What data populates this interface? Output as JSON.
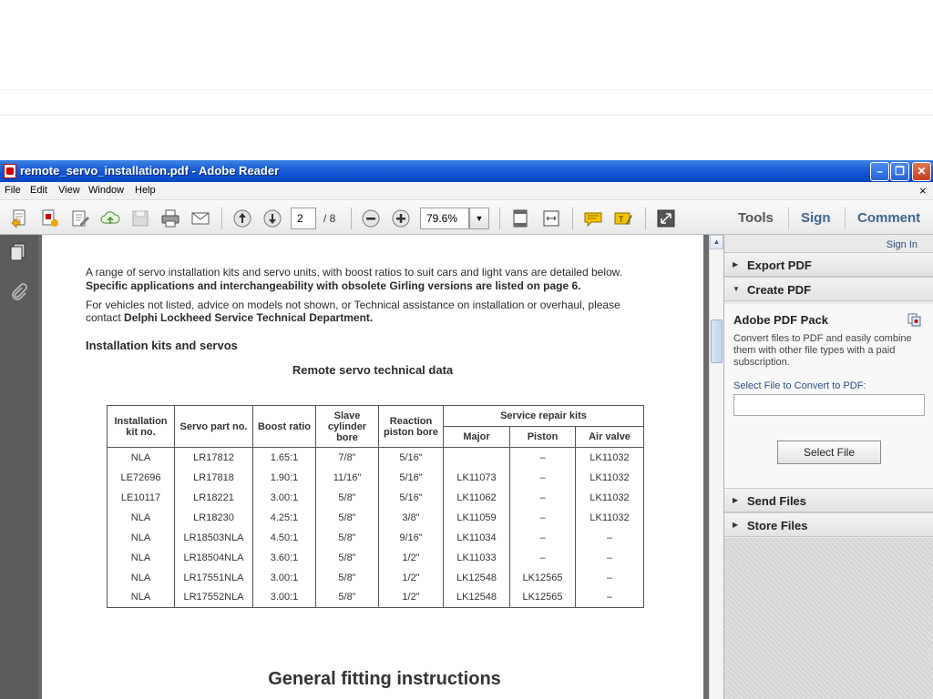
{
  "window": {
    "title": "remote_servo_installation.pdf - Adobe Reader",
    "close_symbol": "✕",
    "maximize_symbol": "❐",
    "minimize_symbol": "–"
  },
  "menu": {
    "items": [
      "File",
      "Edit",
      "View",
      "Window",
      "Help"
    ],
    "close_symbol": "×"
  },
  "toolbar": {
    "page_current": "2",
    "page_total": "/  8",
    "zoom": "79.6%",
    "zoom_drop_symbol": "▼",
    "tools_label": "Tools",
    "sign_label": "Sign",
    "comment_label": "Comment"
  },
  "document": {
    "intro_line1": "A range of servo installation kits and servo units, with boost ratios to suit cars and light vans are detailed below.",
    "intro_line1_bold": "Specific applications and interchangeability with obsolete Girling versions are listed on page 6.",
    "intro_line2": "For vehicles not listed, advice on models not shown, or Technical assistance on installation or overhaul, please",
    "intro_line2b_prefix": "contact ",
    "intro_line2b_bold": "Delphi Lockheed Service Technical Department.",
    "section_heading": "Installation kits and servos",
    "table_title": "Remote servo technical data",
    "table_headers": {
      "installation_kit": "Installation kit no.",
      "servo_part": "Servo part no.",
      "boost_ratio": "Boost ratio",
      "slave_bore": "Slave cylinder bore",
      "reaction_bore": "Reaction piston bore",
      "service_kits": "Service repair kits",
      "major": "Major",
      "piston": "Piston",
      "air_valve": "Air valve"
    },
    "table_rows": [
      [
        "NLA",
        "LR17812",
        "1.65:1",
        "7/8\"",
        "5/16\"",
        "",
        "–",
        "LK11032"
      ],
      [
        "LE72696",
        "LR17818",
        "1.90:1",
        "11/16\"",
        "5/16\"",
        "LK11073",
        "–",
        "LK11032"
      ],
      [
        "LE10117",
        "LR18221",
        "3.00:1",
        "5/8\"",
        "5/16\"",
        "LK11062",
        "–",
        "LK11032"
      ],
      [
        "NLA",
        "LR18230",
        "4.25:1",
        "5/8\"",
        "3/8\"",
        "LK11059",
        "–",
        "LK11032"
      ],
      [
        "NLA",
        "LR18503NLA",
        "4.50:1",
        "5/8\"",
        "9/16\"",
        "LK11034",
        "–",
        "–"
      ],
      [
        "NLA",
        "LR18504NLA",
        "3.60:1",
        "5/8\"",
        "1/2\"",
        "LK11033",
        "–",
        "–"
      ],
      [
        "NLA",
        "LR17551NLA",
        "3.00:1",
        "5/8\"",
        "1/2\"",
        "LK12548",
        "LK12565",
        "–"
      ],
      [
        "NLA",
        "LR17552NLA",
        "3.00:1",
        "5/8\"",
        "1/2\"",
        "LK12548",
        "LK12565",
        "–"
      ]
    ],
    "next_heading": "General fitting instructions"
  },
  "scrollbar": {
    "up_symbol": "▲"
  },
  "right_pane": {
    "sign_in": "Sign In",
    "panels": {
      "export_pdf": "Export PDF",
      "create_pdf": "Create PDF",
      "send_files": "Send Files",
      "store_files": "Store Files"
    },
    "collapsed_arrow": "▶",
    "expanded_arrow": "▼",
    "create": {
      "title": "Adobe PDF Pack",
      "description": "Convert files to PDF and easily combine them with other file types with a paid subscription.",
      "select_label": "Select File to Convert to PDF:",
      "input_value": "",
      "button_label": "Select File"
    }
  },
  "colors": {
    "titlebar": "#0d4fcf",
    "link": "#3d6690",
    "accent_yellow": "#f5c400"
  }
}
